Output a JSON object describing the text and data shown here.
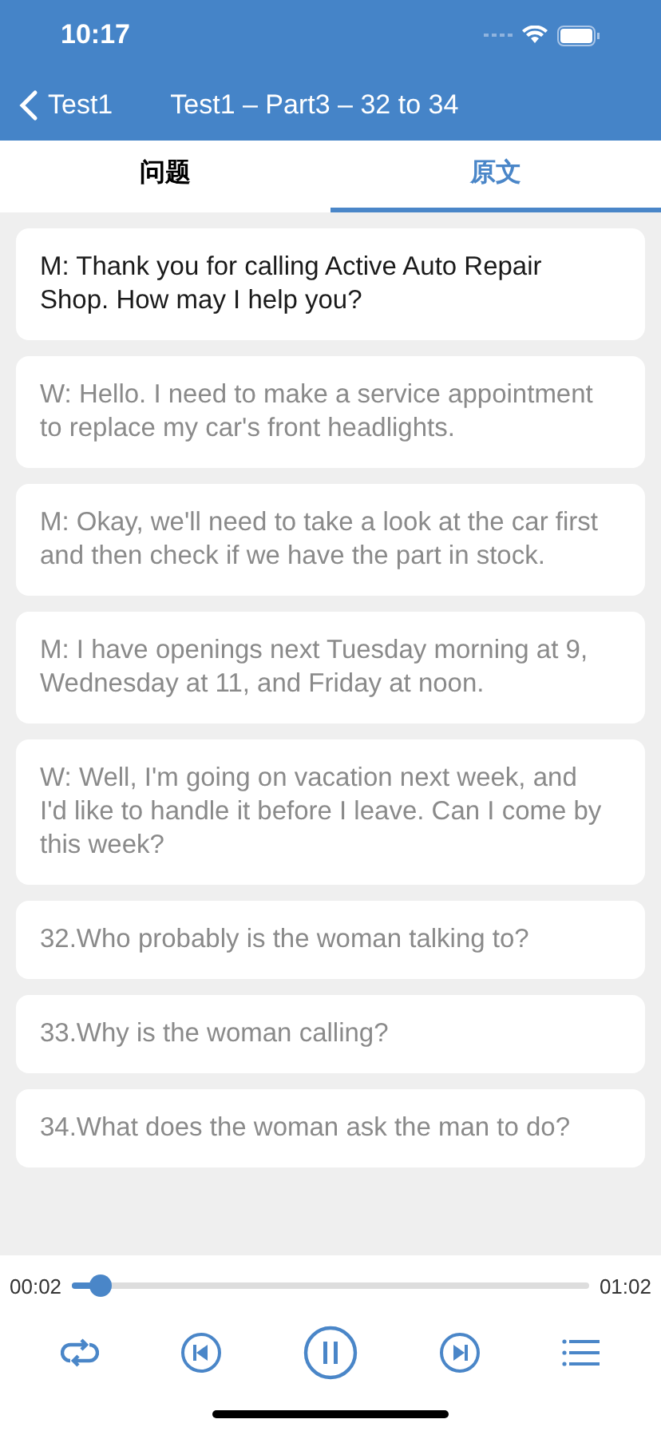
{
  "status_bar": {
    "time": "10:17"
  },
  "nav": {
    "back_label": "Test1",
    "title": "Test1 – Part3 – 32 to 34"
  },
  "tabs": [
    {
      "label": "问题",
      "selected": false
    },
    {
      "label": "原文",
      "selected": true
    }
  ],
  "transcript": [
    {
      "text": "M: Thank you for calling Active Auto Repair Shop. How may I help you?",
      "selected": true
    },
    {
      "text": "W: Hello. I need to make a service appointment to replace my car's front headlights.",
      "selected": false
    },
    {
      "text": "M: Okay, we'll need to take a look at the car first and then check if we have the part in stock.",
      "selected": false
    },
    {
      "text": "M: I have openings next Tuesday morning at 9, Wednesday at 11, and Friday at noon.",
      "selected": false
    },
    {
      "text": "W: Well, I'm going on vacation next week, and I'd like to handle it before I leave. Can I come by this week?",
      "selected": false
    },
    {
      "text": "32.Who probably is the woman talking to?",
      "selected": false
    },
    {
      "text": "33.Why is the woman calling?",
      "selected": false
    },
    {
      "text": "34.What does the woman ask the man to do?",
      "selected": false
    }
  ],
  "player": {
    "elapsed": "00:02",
    "duration": "01:02",
    "level": 0.04,
    "playing": true
  }
}
